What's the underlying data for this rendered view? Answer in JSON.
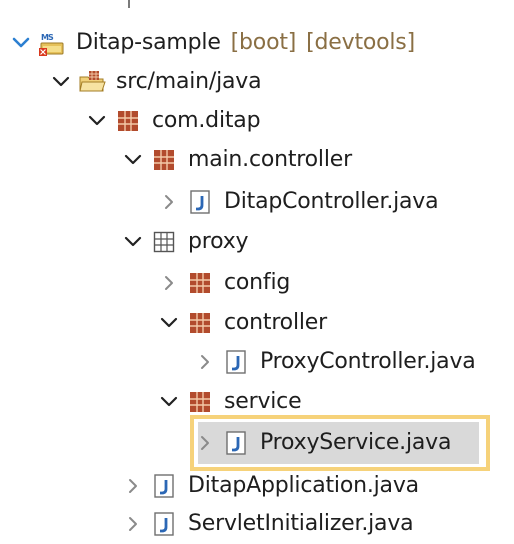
{
  "tree": {
    "root": {
      "label": "Ditap-sample",
      "decorators": [
        "[boot]",
        "[devtools]"
      ]
    },
    "items": [
      {
        "label": "src/main/java"
      },
      {
        "label": "com.ditap"
      },
      {
        "label": "main.controller"
      },
      {
        "label": "DitapController.java"
      },
      {
        "label": "proxy"
      },
      {
        "label": "config"
      },
      {
        "label": "controller"
      },
      {
        "label": "ProxyController.java"
      },
      {
        "label": "service"
      },
      {
        "label": "ProxyService.java"
      },
      {
        "label": "DitapApplication.java"
      },
      {
        "label": "ServletInitializer.java"
      }
    ]
  },
  "colors": {
    "selection_highlight": "#f6d27a",
    "selected_row_bg": "#d9d9d9",
    "expand_chevron": "#2c7fd1",
    "package_icon": "#b24b2d",
    "java_icon": "#2b67b5"
  },
  "icons": {
    "root": "spring-project-icon",
    "src_folder": "source-folder-icon",
    "package": "package-icon",
    "empty_package": "empty-package-icon",
    "java_file": "java-file-icon"
  },
  "selected_item": "ProxyService.java"
}
